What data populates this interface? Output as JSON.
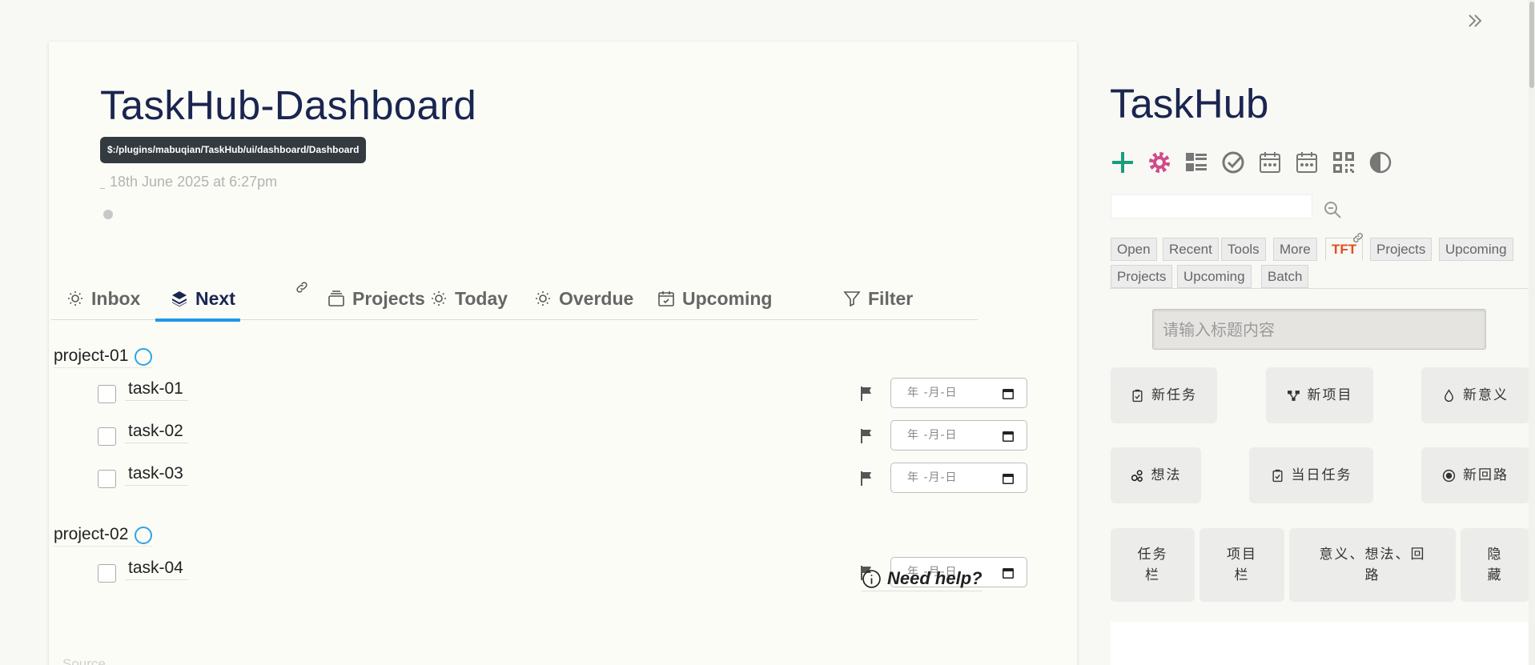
{
  "story": {
    "title": "TaskHub-Dashboard",
    "tooltip": "$:/plugins/mabuqian/TaskHub/ui/dashboard/Dashboard",
    "subtitle": "18th June 2025 at 6:27pm",
    "source_label": "Source"
  },
  "tabs": [
    {
      "label": "Inbox",
      "icon": "sun-icon"
    },
    {
      "label": "Next",
      "icon": "layers-icon",
      "active": true
    },
    {
      "label": "Projects",
      "icon": "stack-icon"
    },
    {
      "label": "Today",
      "icon": "sun-icon"
    },
    {
      "label": "Overdue",
      "icon": "sun-icon"
    },
    {
      "label": "Upcoming",
      "icon": "calendar-check-icon"
    },
    {
      "label": "Filter",
      "icon": "funnel-icon"
    }
  ],
  "projects": [
    {
      "name": "project-01",
      "tasks": [
        "task-01",
        "task-02",
        "task-03"
      ]
    },
    {
      "name": "project-02",
      "tasks": [
        "task-04"
      ]
    }
  ],
  "date_placeholder": "年 -月-日",
  "help_label": "Need help?",
  "sidebar": {
    "title": "TaskHub",
    "toolbar_icons": [
      "plus-icon",
      "gear-icon",
      "list-icon",
      "check-circle-icon",
      "calendar-icon",
      "calendar-icon",
      "qr-icon",
      "contrast-icon"
    ],
    "search_value": "",
    "tabs_row1": [
      "Open",
      "Recent",
      "Tools",
      "More",
      "TFT",
      "Projects",
      "Upcoming"
    ],
    "tabs_row2": [
      "Projects",
      "Upcoming",
      "Batch"
    ],
    "active_tab": "TFT",
    "input_placeholder": "请输入标题内容",
    "buttons": {
      "new_task": "新任务",
      "new_project": "新项目",
      "new_meaning": "新意义",
      "idea": "想法",
      "day_task": "当日任务",
      "new_loop": "新回路",
      "task_bar_1": "任务",
      "task_bar_2": "栏",
      "project_bar_1": "项目",
      "project_bar_2": "栏",
      "meaning_1": "意义、想法、回",
      "meaning_2": "路",
      "hide_1": "隐",
      "hide_2": "藏"
    }
  },
  "colors": {
    "title": "#1a2550",
    "tab_underline": "#2196e8",
    "project_circle": "#2ea3e8",
    "plus": "#1a9e7a",
    "gear": "#d04a8a",
    "active_sidebar_tab": "#e0501b"
  }
}
